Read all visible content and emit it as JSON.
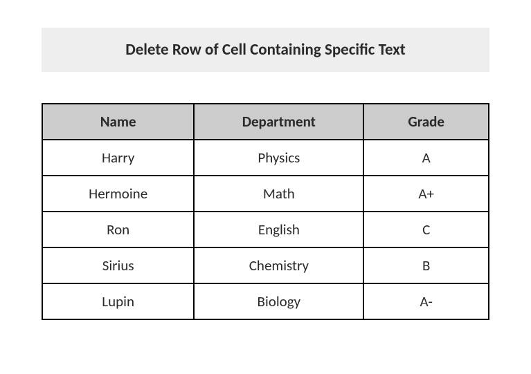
{
  "title": "Delete Row of Cell Containing Specific Text",
  "table": {
    "headers": {
      "name": "Name",
      "department": "Department",
      "grade": "Grade"
    },
    "rows": [
      {
        "name": "Harry",
        "department": "Physics",
        "grade": "A"
      },
      {
        "name": "Hermoine",
        "department": "Math",
        "grade": "A+"
      },
      {
        "name": "Ron",
        "department": "English",
        "grade": "C"
      },
      {
        "name": "Sirius",
        "department": "Chemistry",
        "grade": "B"
      },
      {
        "name": "Lupin",
        "department": "Biology",
        "grade": "A-"
      }
    ]
  }
}
